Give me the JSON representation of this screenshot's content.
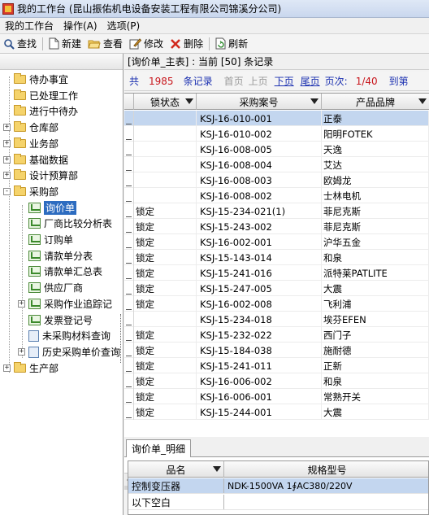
{
  "window": {
    "title": "我的工作台 (昆山振佑机电设备安装工程有限公司锦溪分公司)"
  },
  "menu": [
    "我的工作台",
    "操作(A)",
    "选项(P)"
  ],
  "toolbar": {
    "search": "查找",
    "new": "新建",
    "view": "查看",
    "edit": "修改",
    "delete": "删除",
    "refresh": "刷新"
  },
  "tree": [
    {
      "label": "待办事宜",
      "icon": "folder"
    },
    {
      "label": "已处理工作",
      "icon": "folder"
    },
    {
      "label": "进行中待办",
      "icon": "folder"
    },
    {
      "label": "仓库部",
      "icon": "folder",
      "expander": "+"
    },
    {
      "label": "业务部",
      "icon": "folder",
      "expander": "+"
    },
    {
      "label": "基础数据",
      "icon": "folder",
      "expander": "+"
    },
    {
      "label": "设计预算部",
      "icon": "folder",
      "expander": "+"
    },
    {
      "label": "采购部",
      "icon": "folder",
      "expander": "-"
    },
    {
      "label": "询价单",
      "icon": "sheet",
      "selected": true
    },
    {
      "label": "厂商比较分析表",
      "icon": "sheet"
    },
    {
      "label": "订购单",
      "icon": "sheet"
    },
    {
      "label": "请款单分表",
      "icon": "sheet"
    },
    {
      "label": "请款单汇总表",
      "icon": "sheet"
    },
    {
      "label": "供应厂商",
      "icon": "sheet"
    },
    {
      "label": "采购作业追踪记",
      "icon": "sheet",
      "expander": "+"
    },
    {
      "label": "发票登记号",
      "icon": "sheet"
    },
    {
      "label": "未采购材料查询",
      "icon": "doc"
    },
    {
      "label": "历史采购单价查询",
      "icon": "doc",
      "expander": "+"
    },
    {
      "label": "生产部",
      "icon": "folder",
      "expander": "+"
    }
  ],
  "info": {
    "text": "[询价单_主表] : 当前 [50] 条记录"
  },
  "pager": {
    "total_prefix": "共",
    "total": "1985",
    "total_suffix": "条记录",
    "first": "首页",
    "prev": "上页",
    "next": "下页",
    "last": "尾页",
    "pages_label": "页次:",
    "pages": "1/40",
    "goto": "到第"
  },
  "grid": {
    "columns": [
      "锁状态",
      "采购案号",
      "产品品牌"
    ],
    "rows": [
      {
        "lock": "",
        "no": "KSJ-16-010-001",
        "brand": "正泰"
      },
      {
        "lock": "",
        "no": "KSJ-16-010-002",
        "brand": "阳明FOTEK"
      },
      {
        "lock": "",
        "no": "KSJ-16-008-005",
        "brand": "天逸"
      },
      {
        "lock": "",
        "no": "KSJ-16-008-004",
        "brand": "艾达"
      },
      {
        "lock": "",
        "no": "KSJ-16-008-003",
        "brand": "欧姆龙"
      },
      {
        "lock": "",
        "no": "KSJ-16-008-002",
        "brand": "士林电机"
      },
      {
        "lock": "锁定",
        "no": "KSJ-15-234-021(1)",
        "brand": "菲尼克斯"
      },
      {
        "lock": "锁定",
        "no": "KSJ-15-243-002",
        "brand": "菲尼克斯"
      },
      {
        "lock": "锁定",
        "no": "KSJ-16-002-001",
        "brand": "沪华五金"
      },
      {
        "lock": "锁定",
        "no": "KSJ-15-143-014",
        "brand": "和泉"
      },
      {
        "lock": "锁定",
        "no": "KSJ-15-241-016",
        "brand": "派特莱PATLITE"
      },
      {
        "lock": "锁定",
        "no": "KSJ-15-247-005",
        "brand": "大震"
      },
      {
        "lock": "锁定",
        "no": "KSJ-16-002-008",
        "brand": "飞利浦"
      },
      {
        "lock": "",
        "no": "KSJ-15-234-018",
        "brand": "埃芬EFEN"
      },
      {
        "lock": "锁定",
        "no": "KSJ-15-232-022",
        "brand": "西门子"
      },
      {
        "lock": "锁定",
        "no": "KSJ-15-184-038",
        "brand": "施耐德"
      },
      {
        "lock": "锁定",
        "no": "KSJ-15-241-011",
        "brand": "正新"
      },
      {
        "lock": "锁定",
        "no": "KSJ-16-006-002",
        "brand": "和泉"
      },
      {
        "lock": "锁定",
        "no": "KSJ-16-006-001",
        "brand": "常熟开关"
      },
      {
        "lock": "锁定",
        "no": "KSJ-15-244-001",
        "brand": "大震"
      }
    ]
  },
  "detail": {
    "tab": "询价单_明细",
    "columns": [
      "品名",
      "规格型号"
    ],
    "rows": [
      {
        "name": "控制变压器",
        "spec": "NDK-1500VA 1∮AC380/220V"
      },
      {
        "name": "以下空白",
        "spec": ""
      }
    ]
  },
  "colors": {
    "selection": "#c3d6ef",
    "tree_selected": "#2d6cc0",
    "pager_red": "#c8151b",
    "pager_blue": "#1a2fb0"
  }
}
